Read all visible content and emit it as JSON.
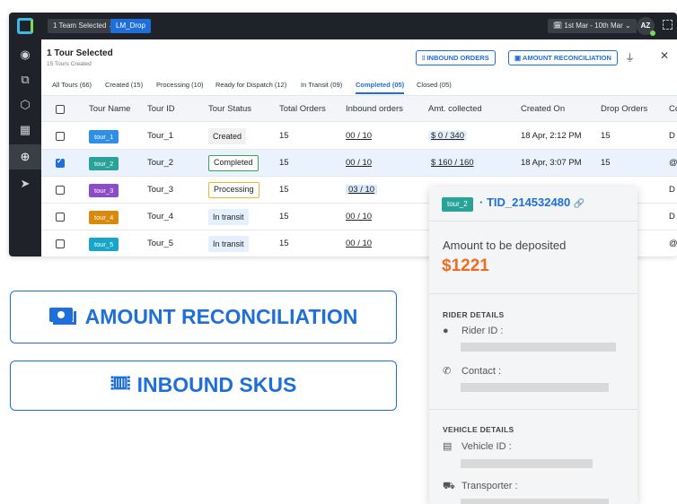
{
  "topbar": {
    "team_chip": "1 Team Selected ⌄",
    "lm_chip": "LM_Drop",
    "date_chip": "🗓 1st Mar - 10th Mar ⌄",
    "avatar": "AZ"
  },
  "header": {
    "title": "1 Tour Selected",
    "subtitle": "15 Tours Created",
    "inbound_btn": "INBOUND ORDERS",
    "amount_btn": "AMOUNT RECONCILIATION"
  },
  "tabs": [
    {
      "label": "All Tours (66)"
    },
    {
      "label": "Created (15)"
    },
    {
      "label": "Processing (10)"
    },
    {
      "label": "Ready for Dispatch (12)"
    },
    {
      "label": "In Transit (09)"
    },
    {
      "label": "Completed (05)"
    },
    {
      "label": "Closed (05)"
    }
  ],
  "columns": [
    "Tour Name",
    "Tour ID",
    "Tour Status",
    "Total Orders",
    "Inbound orders",
    "Amt. collected",
    "Created On",
    "Drop Orders",
    "Co"
  ],
  "rows": [
    {
      "name": "tour_1",
      "id": "Tour_1",
      "status": "Created",
      "total": "15",
      "inbound": "00 / 10",
      "amt": "$ 0 / 340",
      "created": "18 Apr, 2:12 PM",
      "drop": "15",
      "co": "D"
    },
    {
      "name": "tour_2",
      "id": "Tour_2",
      "status": "Completed",
      "total": "15",
      "inbound": "00 / 10",
      "amt": "$ 160 / 160",
      "created": "18 Apr, 3:07 PM",
      "drop": "15",
      "co": "@"
    },
    {
      "name": "tour_3",
      "id": "Tour_3",
      "status": "Processing",
      "total": "15",
      "inbound": "03 / 10",
      "amt": "",
      "created": "",
      "drop": "",
      "co": "D"
    },
    {
      "name": "tour_4",
      "id": "Tour_4",
      "status": "In transit",
      "total": "15",
      "inbound": "00 / 10",
      "amt": "",
      "created": "",
      "drop": "",
      "co": "D"
    },
    {
      "name": "tour_5",
      "id": "Tour_5",
      "status": "In transit",
      "total": "15",
      "inbound": "00 / 10",
      "amt": "",
      "created": "",
      "drop": "",
      "co": "@"
    }
  ],
  "colors": {
    "accent": "#1e6fd9",
    "tour_1": "#2f8fe8",
    "tour_2": "#29a39a",
    "tour_3": "#8e4bc9",
    "tour_4": "#d98a0b",
    "tour_5": "#17a6c9",
    "amount": "#f26b21"
  },
  "big_buttons": {
    "amount": "AMOUNT RECONCILIATION",
    "inbound": "INBOUND SKUS"
  },
  "panel": {
    "chip": "tour_2",
    "tid": "· TID_214532480",
    "amount_label": "Amount to be deposited",
    "amount": "$1221",
    "rider_section": "RIDER DETAILS",
    "rider_id": "Rider ID :",
    "contact": "Contact :",
    "vehicle_section": "VEHICLE DETAILS",
    "vehicle_id": "Vehicle ID :",
    "transporter": "Transporter :"
  }
}
